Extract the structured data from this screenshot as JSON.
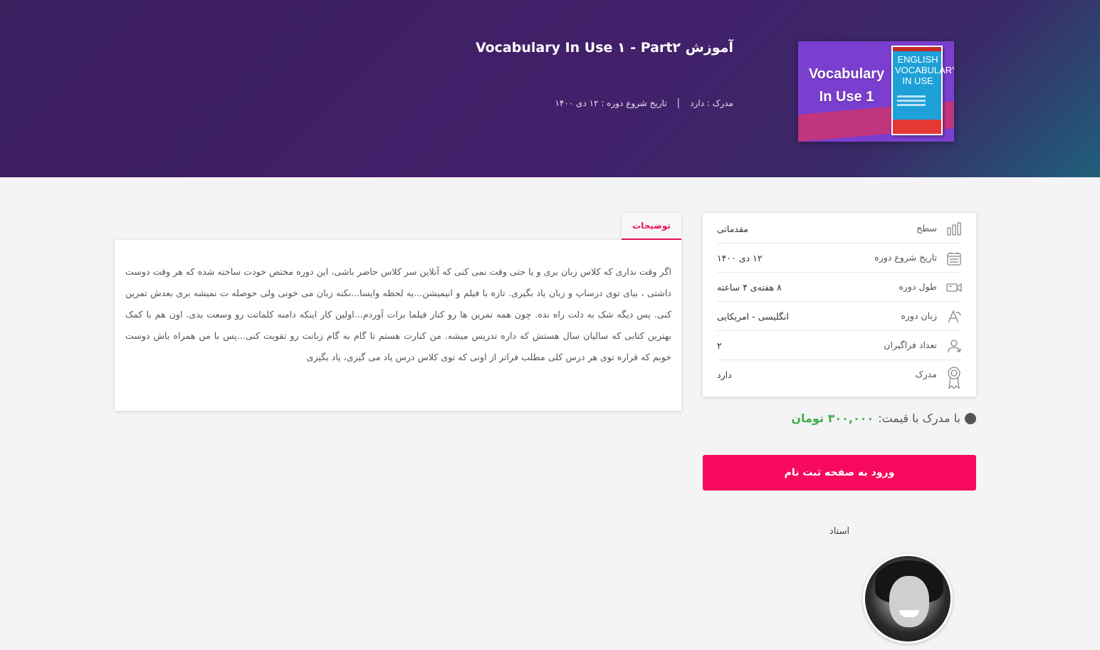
{
  "header": {
    "title": "آموزش Vocabulary In Use ۱ - Part۲",
    "certificate": "مدرک : دارد",
    "start_date": "تاریخ شروع دوره : ۱۲ دی ۱۴۰۰",
    "separator": "|",
    "cover": {
      "title": "Vocabulary In Use 1",
      "book_title": "ENGLISH VOCABULARY IN USE",
      "colors": {
        "purple": "#7b3fd0",
        "pink": "#c0357d",
        "blue": "#1ea0d8"
      }
    }
  },
  "tabs": [
    {
      "label": "توضیحات",
      "active": true
    }
  ],
  "description": "اگر وقت نداری که کلاس زبان بری و یا حتی وقت نمی کنی که آنلاین سر کلاس حاضر باشی، این دوره مختص خودت ساخته شده که هر وقت دوست داشتی ، بیای توی درساپ و زبان یاد بگیری. تازه با فیلم و انیمیشن...یه لحظه وایسا...نکنه زبان می خونی ولی حوصله ت نمیشه بری بعدش تمرین کنی. پس دیگه شک به دلت راه نده. چون همه تمرین ها رو کنار فیلما برات آوردم...اولین کار اینکه دامنه کلماتت رو وسعت بدی. اون هم با کمک بهترین کتابی که سالیان سال هستش که داره تدریس میشه. من کنارت هستم تا گام به گام زبانت رو تقویت کنی...پس با من همراه باش دوست خوبم که قراره توی هر درس کلی مطلب فراتر از اونی که توی کلاس درس یاد می گیری، یاد بگیری",
  "info": [
    {
      "icon": "level-bars-icon",
      "label": "سطح",
      "value": "مقدماتی"
    },
    {
      "icon": "calendar-icon",
      "label": "تاریخ شروع دوره",
      "value": "۱۲ دی ۱۴۰۰"
    },
    {
      "icon": "video-camera-icon",
      "label": "طول دوره",
      "value": "۸ هفته‌ی ۴ ساعته"
    },
    {
      "icon": "language-icon",
      "label": "زبان دوره",
      "value": "انگلیسی - امریکایی"
    },
    {
      "icon": "students-icon",
      "label": "تعداد فراگیران",
      "value": "۲"
    },
    {
      "icon": "certificate-ribbon-icon",
      "label": "مدرک",
      "value": "دارد"
    }
  ],
  "price": {
    "prefix": "با مدرک با قیمت:",
    "amount": "۳۰۰,۰۰۰ تومان",
    "accent": "#3fae49"
  },
  "enroll_button": {
    "label": "ورود به صفحه ثبت نام",
    "color": "#f70a5d"
  },
  "teacher": {
    "label": "استاد"
  }
}
